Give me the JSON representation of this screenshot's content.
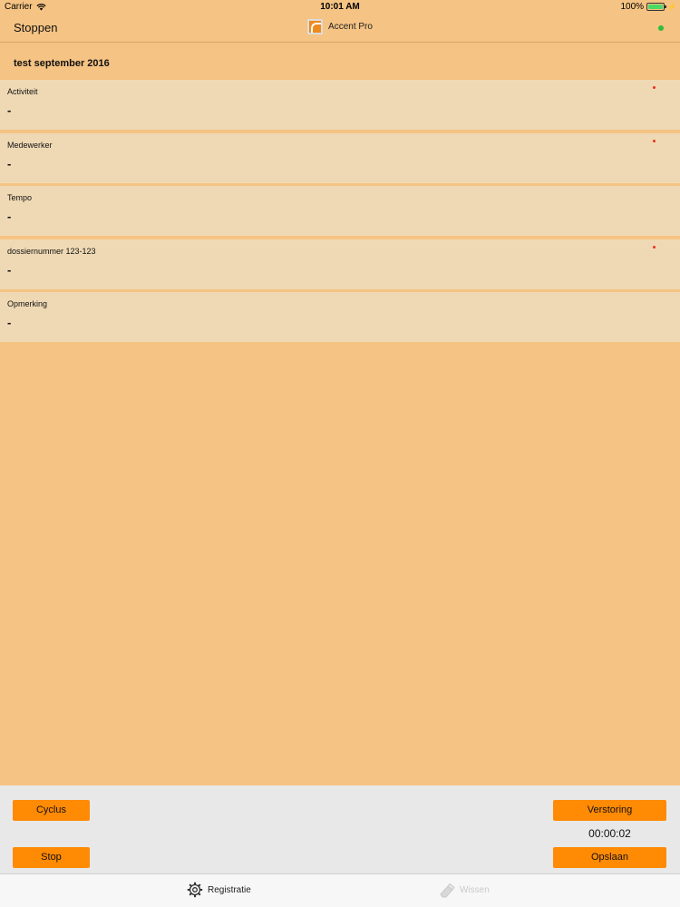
{
  "status_bar": {
    "carrier": "Carrier",
    "time": "10:01 AM",
    "battery": "100%",
    "icons": [
      "wifi-icon",
      "battery-icon",
      "charging-icon"
    ]
  },
  "nav": {
    "back_label": "Stoppen",
    "app_title": "Accent Pro",
    "connection_status_color": "#2dbd3a"
  },
  "project": {
    "name": "test september 2016"
  },
  "fields": [
    {
      "label": "Activiteit",
      "value": "-",
      "required": true
    },
    {
      "label": "Medewerker",
      "value": "-",
      "required": true
    },
    {
      "label": "Tempo",
      "value": "-",
      "required": false
    },
    {
      "label": "dossiernummer 123-123",
      "value": "-",
      "required": true
    },
    {
      "label": "Opmerking",
      "value": "-",
      "required": false
    }
  ],
  "actions": {
    "cyclus_label": "Cyclus",
    "stop_label": "Stop",
    "verstoring_label": "Verstoring",
    "opslaan_label": "Opslaan",
    "timer": "00:00:02"
  },
  "tabs": [
    {
      "label": "Registratie",
      "icon": "gear-icon",
      "active": true
    },
    {
      "label": "Wissen",
      "icon": "eraser-icon",
      "active": false
    }
  ],
  "colors": {
    "background": "#f5c383",
    "field_background": "#efd9b4",
    "button": "#ff8a04",
    "required_marker": "#e8321e"
  }
}
